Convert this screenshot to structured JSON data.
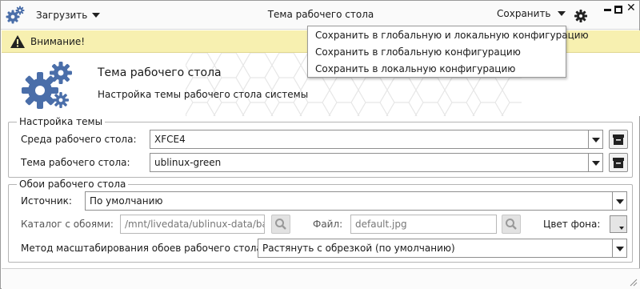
{
  "titlebar": {
    "load_menu": "Загрузить",
    "title": "Тема рабочего стола",
    "save_menu": "Сохранить"
  },
  "warning": {
    "text": "Внимание!"
  },
  "save_dropdown": {
    "items": [
      "Сохранить в глобальную и локальную конфигурацию",
      "Сохранить в глобальную конфигурацию",
      "Сохранить в локальную конфигурацию"
    ]
  },
  "header": {
    "title": "Тема рабочего стола",
    "subtitle": "Настройка темы рабочего стола системы"
  },
  "theme_group": {
    "legend": "Настройка темы",
    "desktop_env_label": "Среда рабочего стола:",
    "desktop_env_value": "XFCE4",
    "theme_label": "Тема рабочего стола:",
    "theme_value": "ublinux-green"
  },
  "wallpaper_group": {
    "legend": "Обои рабочего стола",
    "source_label": "Источник:",
    "source_value": "По умолчанию",
    "dir_label": "Каталог с обоями:",
    "dir_value": "/mnt/livedata/ublinux-data/ba",
    "file_label": "Файл:",
    "file_value": "default.jpg",
    "bg_color_label": "Цвет фона:",
    "scale_label": "Метод масштабирования обоев рабочего стола:",
    "scale_value": "Растянуть с обрезкой (по умолчанию)"
  },
  "colors": {
    "accent_icon": "#4a6ea9",
    "warning_bg": "#f7f0b0"
  }
}
